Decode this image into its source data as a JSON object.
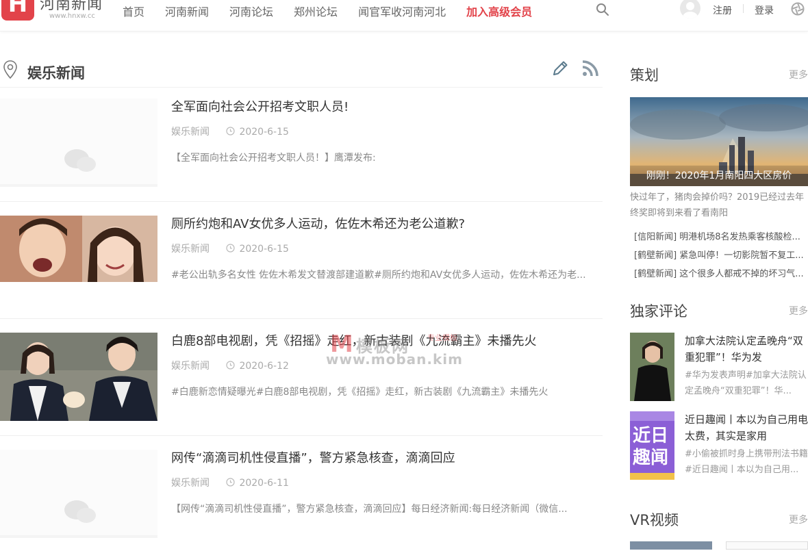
{
  "header": {
    "logo_char": "H",
    "logo_name": "河南新闻",
    "logo_url": "www.hnxw.cc",
    "nav": [
      "首页",
      "河南新闻",
      "河南论坛",
      "郑州论坛",
      "闻官军收河南河北"
    ],
    "vip_link": "加入高级会员",
    "register": "注册",
    "login": "登录",
    "accent_color": "#e2434a"
  },
  "main": {
    "section_title": "娱乐新闻",
    "articles": [
      {
        "title": "全军面向社会公开招考文职人员!",
        "category": "娱乐新闻",
        "date": "2020-6-15",
        "summary": "【全军面向社会公开招考文职人员！】鹰潭发布:"
      },
      {
        "title": "厕所约炮和AV女优多人运动，佐佐木希还为老公道歉?",
        "category": "娱乐新闻",
        "date": "2020-6-15",
        "summary": "#老公出轨多名女性 佐佐木希发文替渡部建道歉#厕所约炮和AV女优多人运动，佐佐木希还为老..."
      },
      {
        "title": "白鹿8部电视剧，凭《招摇》走红，新古装剧《九流霸主》未播先火",
        "category": "娱乐新闻",
        "date": "2020-6-12",
        "summary": "#白鹿新恋情疑曝光#白鹿8部电视剧，凭《招摇》走红，新古装剧《九流霸主》未播先火"
      },
      {
        "title": "网传“滴滴司机性侵直播”，警方紧急核查，滴滴回应",
        "category": "娱乐新闻",
        "date": "2020-6-11",
        "summary": "【网传“滴滴司机性侵直播”，警方紧急核查，滴滴回应】每日经济新闻:每日经济新闻（微信..."
      }
    ]
  },
  "sidebar": {
    "more_label": "更多",
    "plan": {
      "title": "策划",
      "feature_caption": "刚刚！2020年1月南阳四大区房价",
      "feature_desc": "快过年了，猪肉会掉价吗？2019已经过去年终奖即将到来看了看南阳",
      "links": [
        "[信阳新闻] 明港机场8名发热乘客核酸检...",
        "[鹤壁新闻] 紧急叫停！一切影院暂不复工...",
        "[鹤壁新闻] 这个很多人都戒不掉的坏习气..."
      ]
    },
    "comments": {
      "title": "独家评论",
      "items": [
        {
          "title": "加拿大法院认定孟晚舟“双重犯罪”！华为发",
          "desc": "#华为发表声明#加拿大法院认定孟晚舟“双重犯罪”！华..."
        },
        {
          "title": "近日趣闻丨本以为自己用电太费，其实是家用",
          "desc": "#小偷被抓时身上携带刑法书籍#近日趣闻丨本以为自己用...",
          "thumb_text": "近日趣闻"
        }
      ]
    },
    "vr": {
      "title": "VR视频"
    }
  },
  "watermark": {
    "mark": "M",
    "name": "模板网",
    "tag": "专业模板",
    "url": "www.moban.kim"
  }
}
